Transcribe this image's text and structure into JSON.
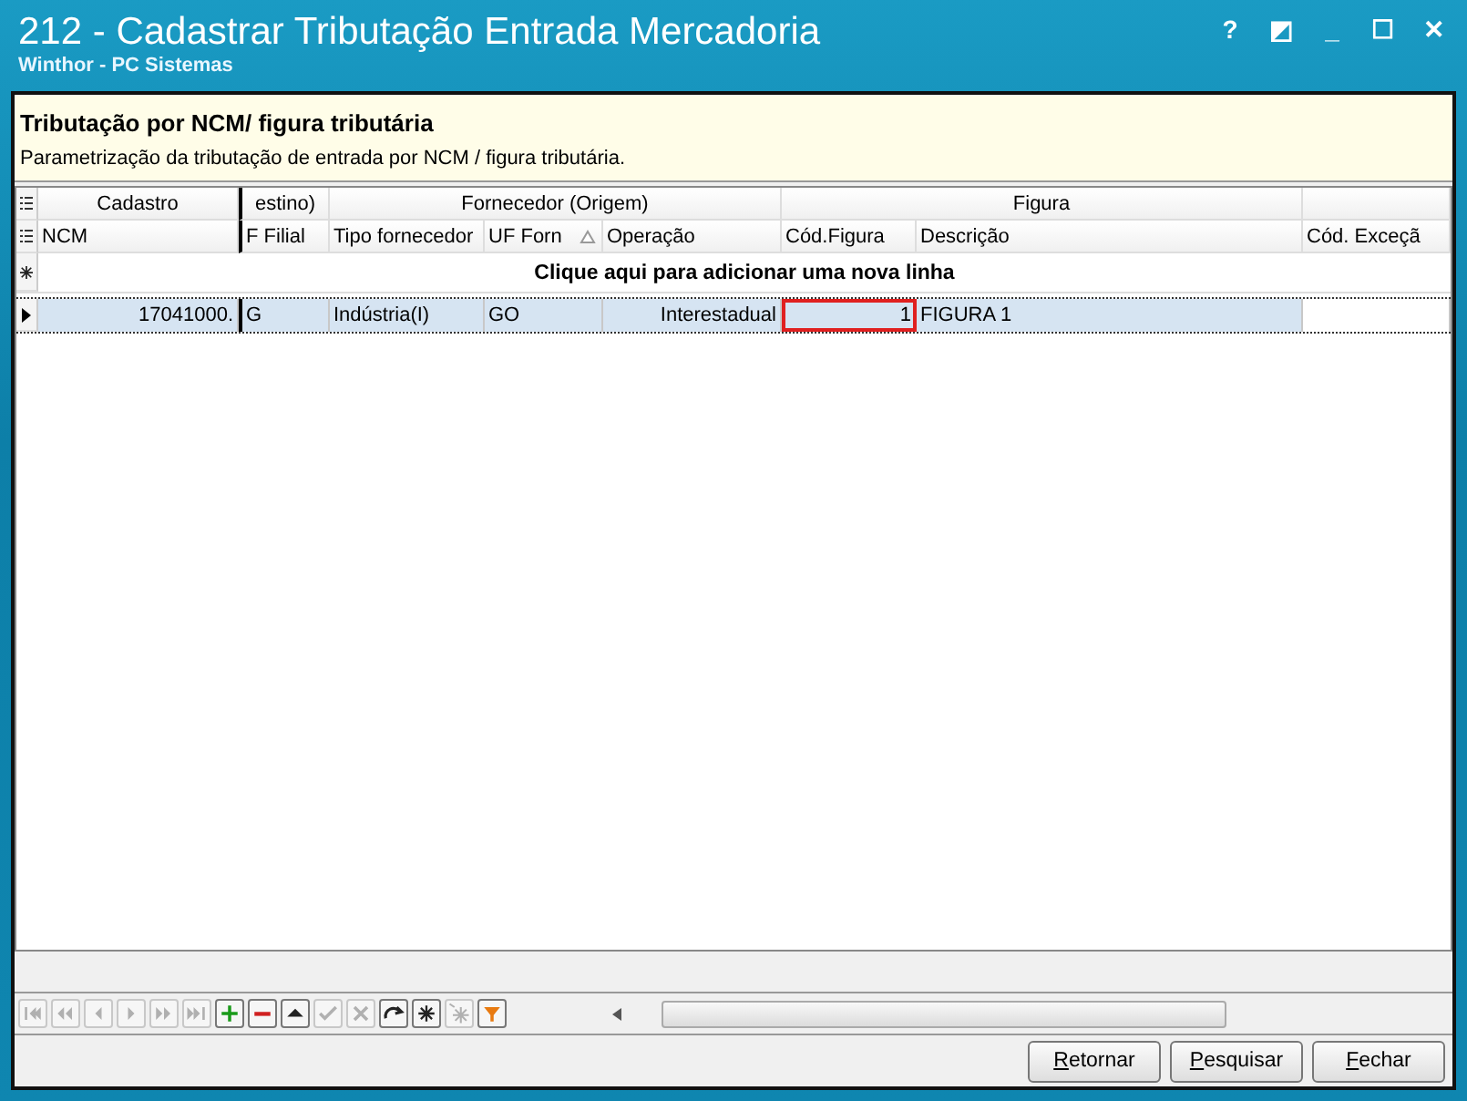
{
  "window": {
    "title": "212 - Cadastrar Tributação Entrada Mercadoria",
    "subtitle": "Winthor - PC Sistemas",
    "controls": [
      "?",
      "◩",
      "_",
      "☐",
      "✕"
    ]
  },
  "header": {
    "title": "Tributação por NCM/ figura tributária",
    "description": "Parametrização da tributação de entrada por NCM / figura tributária."
  },
  "grid": {
    "bands": [
      "Cadastro",
      "estino)",
      "Fornecedor (Origem)",
      "Figura"
    ],
    "columns": [
      {
        "label": "NCM",
        "sorted": false
      },
      {
        "label": "F Filial",
        "sorted": false
      },
      {
        "label": "Tipo fornecedor",
        "sorted": false
      },
      {
        "label": "UF Forn",
        "sorted": true
      },
      {
        "label": "Operação",
        "sorted": false
      },
      {
        "label": "Cód.Figura",
        "sorted": false
      },
      {
        "label": "Descrição",
        "sorted": false
      },
      {
        "label": "Cód. Exceçã",
        "sorted": false
      }
    ],
    "new_row": "Clique aqui para adicionar uma nova linha",
    "rows": [
      {
        "selected": true,
        "cells": [
          {
            "text": "17041000.",
            "highlighted": false
          },
          {
            "text": "G",
            "highlighted": false
          },
          {
            "text": "Indústria(I)",
            "highlighted": false
          },
          {
            "text": "GO",
            "highlighted": false
          },
          {
            "text": "Interestadual",
            "highlighted": false
          },
          {
            "text": "1",
            "highlighted": true
          },
          {
            "text": "FIGURA 1",
            "highlighted": false
          },
          {
            "highlighted": false
          }
        ]
      }
    ]
  },
  "navigator": [
    {
      "kind": "first",
      "disabled": true
    },
    {
      "kind": "prev-page",
      "disabled": true
    },
    {
      "kind": "prev",
      "disabled": true
    },
    {
      "kind": "next",
      "disabled": true
    },
    {
      "kind": "next-page",
      "disabled": true
    },
    {
      "kind": "last",
      "disabled": true
    },
    {
      "kind": "add",
      "disabled": false
    },
    {
      "kind": "delete",
      "disabled": false
    },
    {
      "kind": "edit",
      "disabled": false
    },
    {
      "kind": "post",
      "disabled": true
    },
    {
      "kind": "cancel",
      "disabled": true
    },
    {
      "kind": "refresh",
      "disabled": false
    },
    {
      "kind": "star",
      "disabled": false
    },
    {
      "kind": "star-arrow",
      "disabled": true
    },
    {
      "kind": "filter",
      "disabled": false
    }
  ],
  "buttons": [
    "Retornar",
    "Pesquisar",
    "Fechar"
  ]
}
